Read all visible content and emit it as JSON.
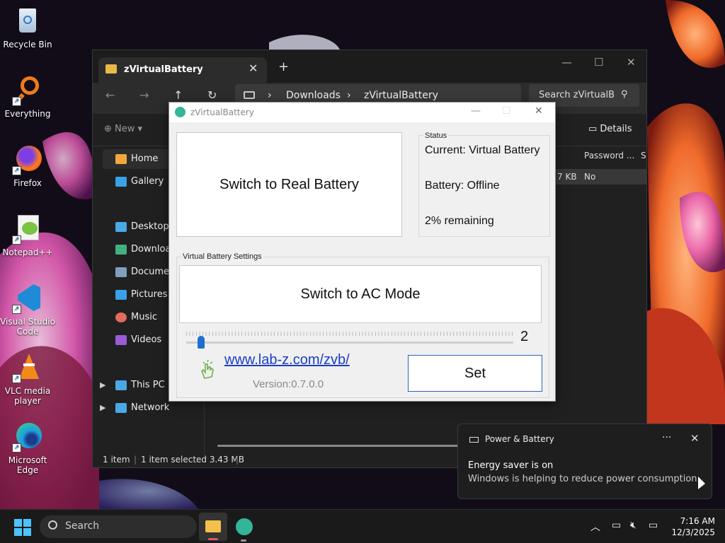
{
  "desktop": {
    "icons": [
      {
        "label": "Recycle Bin"
      },
      {
        "label": "Everything"
      },
      {
        "label": "Firefox"
      },
      {
        "label": "Notepad++"
      },
      {
        "label": "Visual Studio Code"
      },
      {
        "label": "VLC media player"
      },
      {
        "label": "Microsoft Edge"
      }
    ]
  },
  "explorer": {
    "tab_title": "zVirtualBattery",
    "tab_close": "✕",
    "new_tab": "+",
    "window_controls": {
      "minimize": "—",
      "maximize": "☐",
      "close": "✕"
    },
    "nav": {
      "back": "←",
      "forward": "→",
      "up": "↑",
      "refresh": "↻"
    },
    "breadcrumb": {
      "sep": "›",
      "items": [
        "Downloads",
        "zVirtualBattery"
      ]
    },
    "search_placeholder": "Search zVirtualB",
    "command": {
      "new_label": "New",
      "details_label": "Details"
    },
    "sidebar": {
      "items": [
        {
          "label": "Home",
          "icon": "home-icon",
          "color": "#f2a93b"
        },
        {
          "label": "Gallery",
          "icon": "gallery-icon",
          "color": "#3aa0e8"
        },
        {
          "label": "Desktop",
          "icon": "desktop-icon",
          "color": "#4aa8e6"
        },
        {
          "label": "Downloads",
          "icon": "download-icon",
          "color": "#3fb27f"
        },
        {
          "label": "Documents",
          "icon": "documents-icon",
          "color": "#7f9fbf"
        },
        {
          "label": "Pictures",
          "icon": "pictures-icon",
          "color": "#3aa0e8"
        },
        {
          "label": "Music",
          "icon": "music-icon",
          "color": "#e56b5b"
        },
        {
          "label": "Videos",
          "icon": "videos-icon",
          "color": "#9a5cd6"
        },
        {
          "label": "This PC",
          "icon": "pc-icon",
          "color": "#4aa8e6"
        },
        {
          "label": "Network",
          "icon": "network-icon",
          "color": "#4aa8e6"
        }
      ]
    },
    "columns": {
      "password": "Password ...",
      "size": "Si"
    },
    "row": {
      "size_fragment": "7 KB",
      "password": "No"
    },
    "status": {
      "items": "1 item",
      "selected": "1 item selected  3.43 MB"
    }
  },
  "zvb": {
    "title": "zVirtualBattery",
    "window_controls": {
      "minimize": "—",
      "maximize": "☐",
      "close": "✕"
    },
    "switch_battery_label": "Switch to Real Battery",
    "status": {
      "caption": "Status",
      "current": "Current: Virtual Battery",
      "battery": "Battery: Offline",
      "remaining": "2% remaining"
    },
    "settings_caption": "Virtual Battery Settings",
    "switch_mode_label": "Switch to AC Mode",
    "slider": {
      "value": 2,
      "min": 0,
      "max": 100,
      "value_label": "2"
    },
    "link": "www.lab-z.com/zvb/",
    "version": "Version:0.7.0.0",
    "set_label": "Set"
  },
  "notification": {
    "app": "Power & Battery",
    "more": "···",
    "close": "✕",
    "heading": "Energy saver is on",
    "body": "Windows is helping to reduce power consumption."
  },
  "taskbar": {
    "search_label": "Search",
    "time": "7:16 AM",
    "date": "12/3/2025",
    "tray_chevron": "︿"
  },
  "colors": {
    "accent": "#1e6fd0",
    "link": "#1a3ec8",
    "zvb_logo": "#33b59a",
    "windows_blue": "#4cc2ff"
  }
}
